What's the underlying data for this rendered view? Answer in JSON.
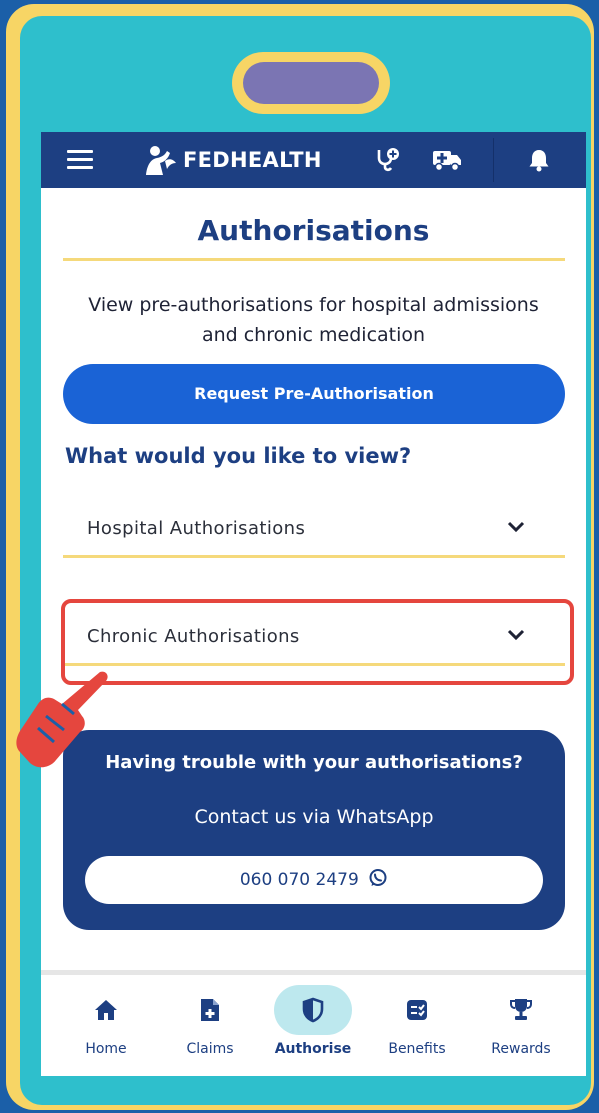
{
  "colors": {
    "frame": "#f7d565",
    "phone_bg": "#2ebfcc",
    "brand_dark": "#1d3f82",
    "primary_button": "#1a63d6",
    "accent_line": "#f5d97b",
    "highlight": "#e5463e",
    "active_tab_bg": "#bde8ee"
  },
  "topbar": {
    "brand": "FEDHEALTH",
    "icons": [
      "menu-icon",
      "fedhealth-logo-icon",
      "doctor-plus-icon",
      "ambulance-icon",
      "bell-icon"
    ]
  },
  "page": {
    "title": "Authorisations",
    "subtitle": "View pre-authorisations for hospital admissions and chronic medication",
    "request_button": "Request Pre-Authorisation",
    "question": "What would you like to view?",
    "dropdowns": [
      {
        "label": "Hospital Authorisations"
      },
      {
        "label": "Chronic Authorisations"
      }
    ]
  },
  "help": {
    "title": "Having trouble with your authorisations?",
    "subtitle": "Contact us via WhatsApp",
    "phone": "060 070 2479"
  },
  "nav": {
    "items": [
      {
        "label": "Home",
        "icon": "home-icon"
      },
      {
        "label": "Claims",
        "icon": "claims-icon"
      },
      {
        "label": "Authorise",
        "icon": "shield-icon",
        "active": true
      },
      {
        "label": "Benefits",
        "icon": "benefits-icon"
      },
      {
        "label": "Rewards",
        "icon": "trophy-icon"
      }
    ]
  }
}
